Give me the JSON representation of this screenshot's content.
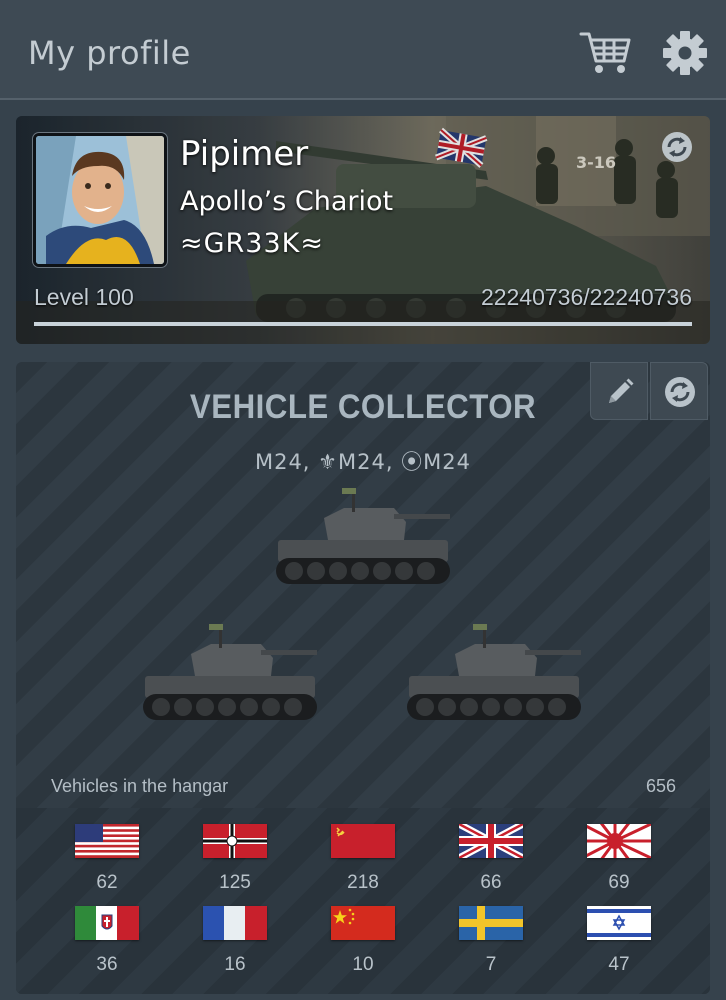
{
  "header": {
    "title": "My profile",
    "cart_icon": "cart-icon",
    "settings_icon": "gear-icon"
  },
  "profile": {
    "name": "Pipimer",
    "title": "Apollo’s Chariot",
    "clan": "≈GR33K≈",
    "level": "Level 100",
    "xp": "22240736/22240736",
    "xp_progress": 1.0,
    "refresh_icon": "refresh-icon"
  },
  "achievement": {
    "title": "VEHICLE COLLECTOR",
    "subtitle": "M24, ⚜M24, ⦿M24",
    "edit_icon": "pencil-icon",
    "refresh_icon": "refresh-icon"
  },
  "hangar": {
    "label": "Vehicles in the hangar",
    "count": "656",
    "nations": [
      {
        "flag": "usa-flag",
        "count": "62"
      },
      {
        "flag": "germany-flag",
        "count": "125"
      },
      {
        "flag": "ussr-flag",
        "count": "218"
      },
      {
        "flag": "uk-flag",
        "count": "66"
      },
      {
        "flag": "japan-flag",
        "count": "69"
      },
      {
        "flag": "italy-flag",
        "count": "36"
      },
      {
        "flag": "france-flag",
        "count": "16"
      },
      {
        "flag": "china-flag",
        "count": "10"
      },
      {
        "flag": "sweden-flag",
        "count": "7"
      },
      {
        "flag": "israel-flag",
        "count": "47"
      }
    ]
  }
}
